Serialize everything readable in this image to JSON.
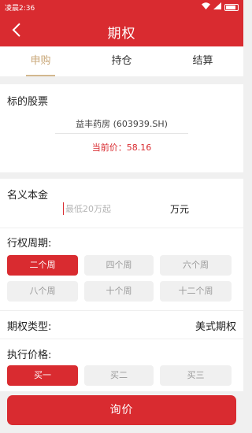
{
  "status_bar": {
    "time": "凌晨2:36"
  },
  "header": {
    "title": "期权"
  },
  "tabs": [
    {
      "label": "申购"
    },
    {
      "label": "持仓"
    },
    {
      "label": "结算"
    }
  ],
  "stock": {
    "section_title": "标的股票",
    "name": "益丰药房 (603939.SH)",
    "price_label": "当前价：58.16"
  },
  "notional": {
    "label": "名义本金",
    "placeholder": "最低20万起",
    "value": "",
    "unit": "万元"
  },
  "period": {
    "label": "行权周期:",
    "options": [
      "二个周",
      "四个周",
      "六个周",
      "八个周",
      "十个周",
      "十二个周"
    ],
    "selected": "二个周"
  },
  "option_type": {
    "label": "期权类型:",
    "value": "美式期权"
  },
  "strike": {
    "label": "执行价格:",
    "options": [
      "买一",
      "买二",
      "买三"
    ],
    "selected": "买一"
  },
  "submit": {
    "label": "询价"
  },
  "colors": {
    "brand_red": "#d92b30",
    "tab_active": "#c8a676"
  }
}
